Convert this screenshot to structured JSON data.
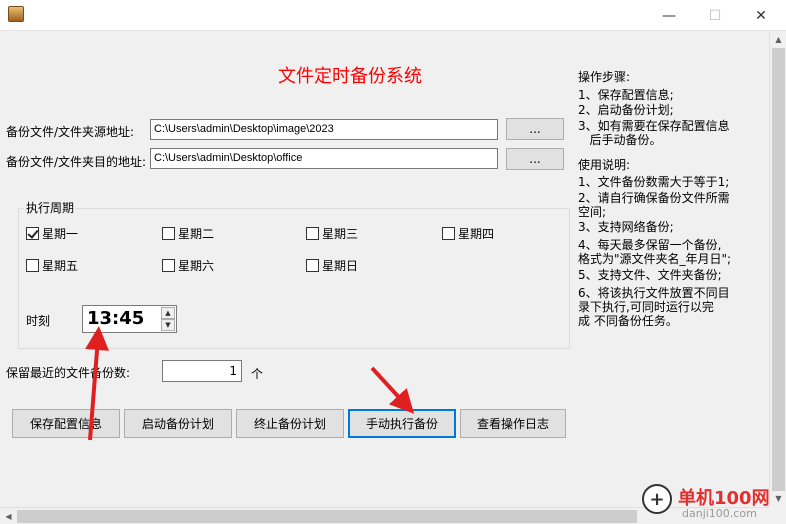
{
  "window": {
    "minimize_glyph": "—",
    "maximize_glyph": "☐",
    "close_glyph": "✕"
  },
  "app_title": "文件定时备份系统",
  "source": {
    "label": "备份文件/文件夹源地址:",
    "value": "C:\\Users\\admin\\Desktop\\image\\2023",
    "browse_label": "..."
  },
  "target": {
    "label": "备份文件/文件夹目的地址:",
    "value": "C:\\Users\\admin\\Desktop\\office",
    "browse_label": "..."
  },
  "schedule": {
    "group_label": "执行周期",
    "days": [
      {
        "label": "星期一",
        "checked": true
      },
      {
        "label": "星期二",
        "checked": false
      },
      {
        "label": "星期三",
        "checked": false
      },
      {
        "label": "星期四",
        "checked": false
      },
      {
        "label": "星期五",
        "checked": false
      },
      {
        "label": "星期六",
        "checked": false
      },
      {
        "label": "星期日",
        "checked": false
      }
    ],
    "time_label": "时刻",
    "time_value": "13:45"
  },
  "retain": {
    "label": "保留最近的文件备份数:",
    "value": "1",
    "unit": "个"
  },
  "buttons": {
    "save": "保存配置信息",
    "start": "启动备份计划",
    "stop": "终止备份计划",
    "manual": "手动执行备份",
    "log": "查看操作日志"
  },
  "help": {
    "steps_title": "操作步骤:",
    "steps": [
      "1、保存配置信息;",
      "2、启动备份计划;",
      "3、如有需要在保存配置信息",
      "   后手动备份。"
    ],
    "usage_title": "使用说明:",
    "usage": [
      "1、文件备份数需大于等于1;",
      "2、请自行确保备份文件所需",
      "空间;",
      "3、支持网络备份;",
      "4、每天最多保留一个备份,",
      "格式为\"源文件夹名_年月日\";",
      "5、支持文件、文件夹备份;",
      "6、将该执行文件放置不同目",
      "录下执行,可同时运行以完",
      "成 不同备份任务。"
    ]
  },
  "watermark": {
    "site": "单机100网",
    "url": "danji100.com",
    "glyph": "+"
  },
  "colors": {
    "title_red": "#ff0000",
    "arrow_red": "#e02020",
    "focus_blue": "#0078d7"
  }
}
